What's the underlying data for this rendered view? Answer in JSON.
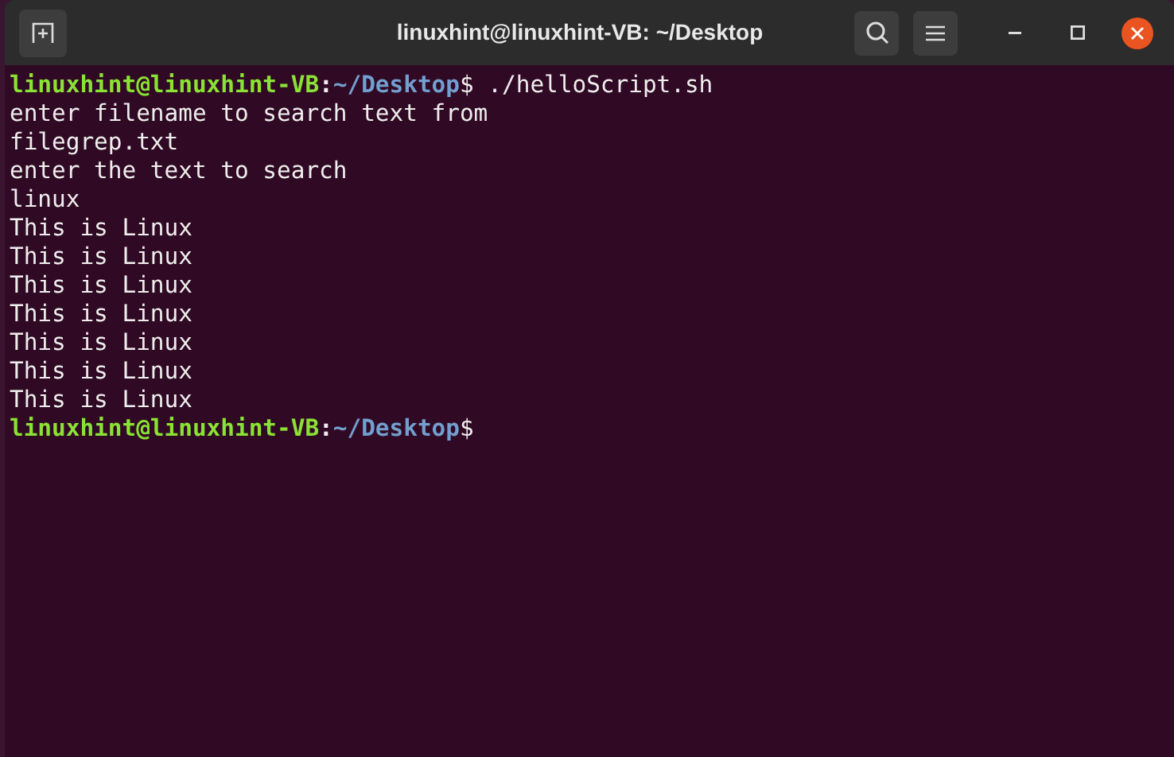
{
  "window": {
    "title": "linuxhint@linuxhint-VB: ~/Desktop"
  },
  "lines": [
    {
      "kind": "prompt",
      "user": "linuxhint@linuxhint-VB",
      "separator": ":",
      "path": "~/Desktop",
      "symbol": "$",
      "command": "./helloScript.sh"
    },
    {
      "kind": "output",
      "text": "enter filename to search text from"
    },
    {
      "kind": "output",
      "text": "filegrep.txt"
    },
    {
      "kind": "output",
      "text": "enter the text to search"
    },
    {
      "kind": "output",
      "text": "linux"
    },
    {
      "kind": "output",
      "text": "This is Linux"
    },
    {
      "kind": "output",
      "text": "This is Linux"
    },
    {
      "kind": "output",
      "text": "This is Linux"
    },
    {
      "kind": "output",
      "text": "This is Linux"
    },
    {
      "kind": "output",
      "text": "This is Linux"
    },
    {
      "kind": "output",
      "text": "This is Linux"
    },
    {
      "kind": "output",
      "text": "This is Linux"
    },
    {
      "kind": "prompt",
      "user": "linuxhint@linuxhint-VB",
      "separator": ":",
      "path": "~/Desktop",
      "symbol": "$"
    }
  ]
}
